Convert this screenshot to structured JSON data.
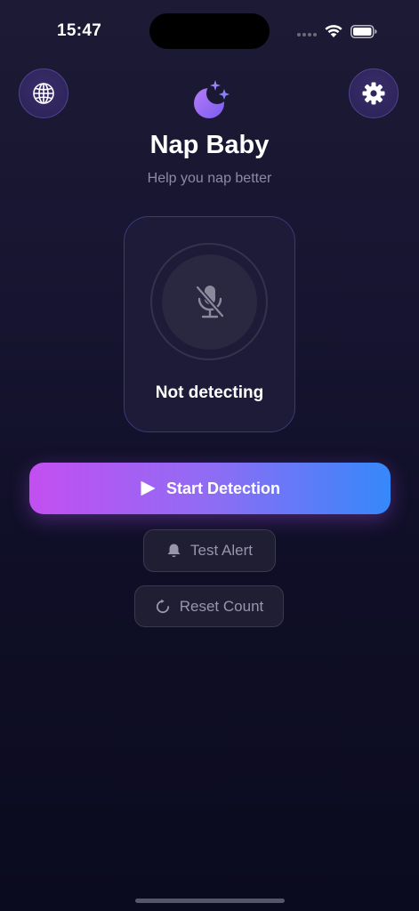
{
  "status_bar": {
    "time": "15:47"
  },
  "header": {
    "title": "Nap Baby",
    "subtitle": "Help you nap better"
  },
  "detector": {
    "status": "Not detecting"
  },
  "actions": {
    "start_label": "Start Detection",
    "test_label": "Test Alert",
    "reset_label": "Reset Count"
  },
  "icons": {
    "language": "globe-icon",
    "settings": "gear-icon",
    "logo": "moon-stars-icon",
    "mic": "mic-off-icon",
    "play": "play-icon",
    "bell": "bell-icon",
    "reset": "reset-icon"
  },
  "colors": {
    "gradient_start": "#c34ff1",
    "gradient_end": "#3588fb",
    "accent_purple": "#8f6cf4"
  }
}
